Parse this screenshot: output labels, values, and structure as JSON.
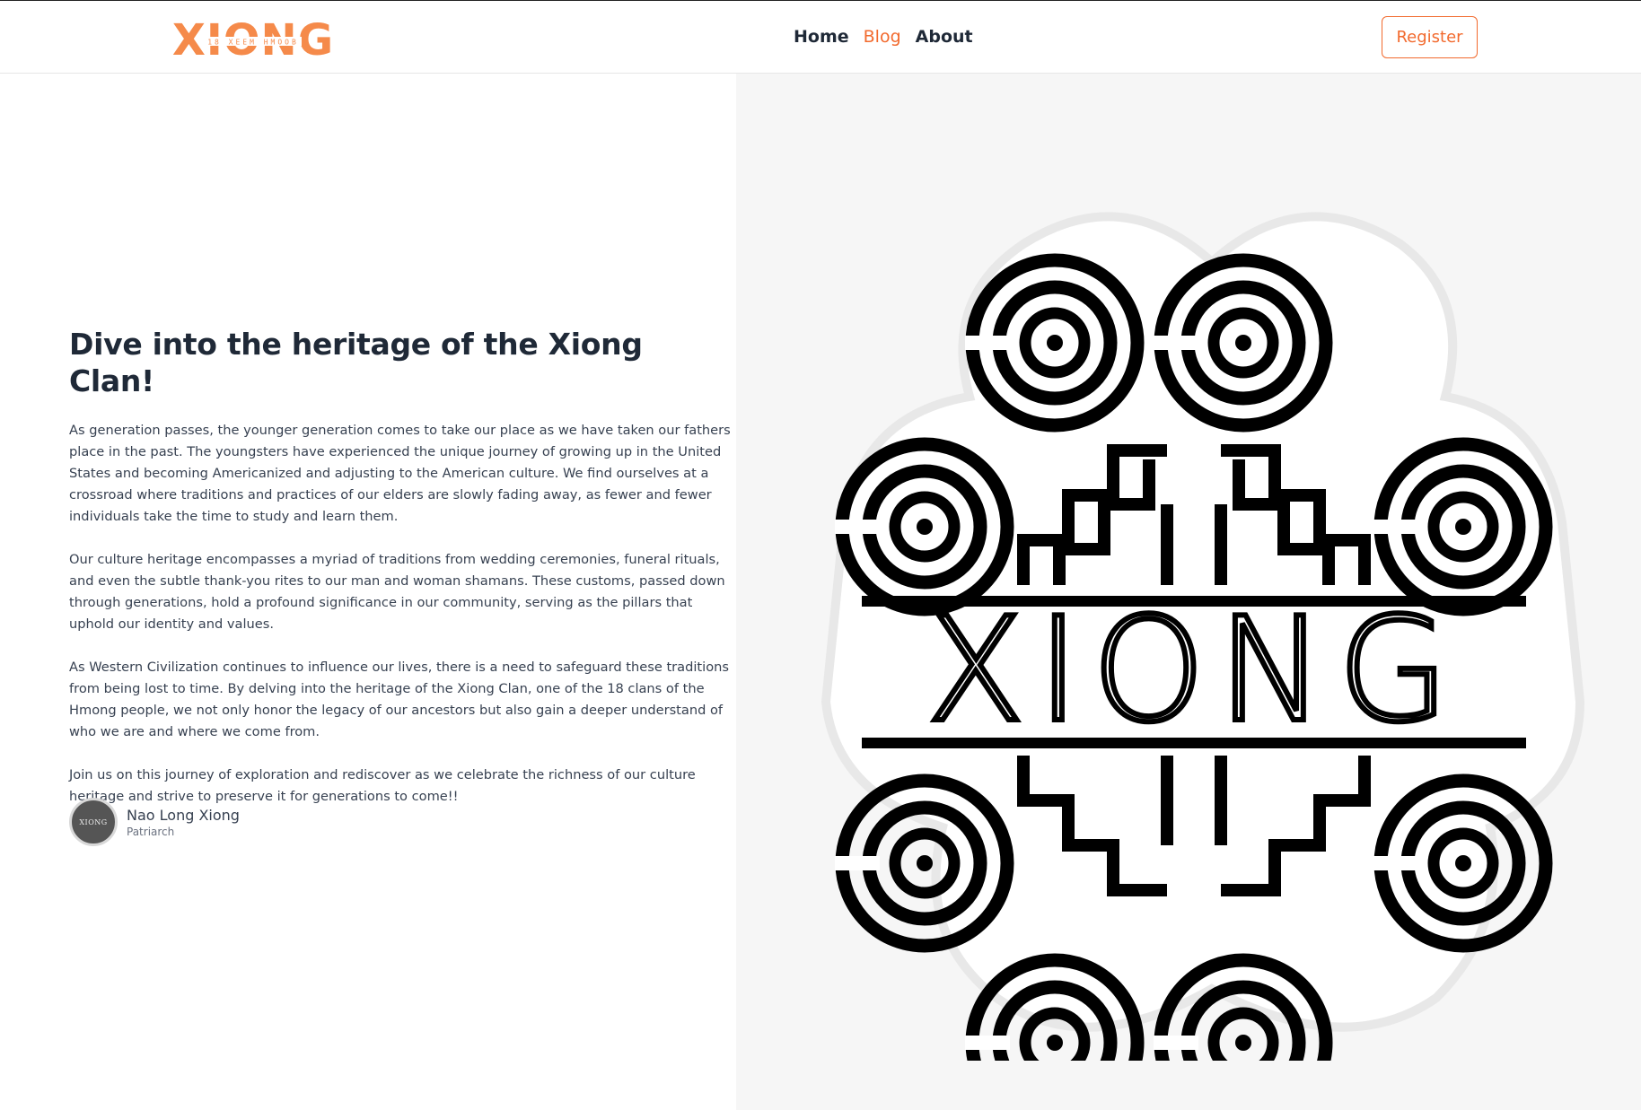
{
  "header": {
    "logo_text": "XIONG",
    "logo_subtext": "18 XEEM HMOOB",
    "nav": [
      {
        "label": "Home"
      },
      {
        "label": "Blog"
      },
      {
        "label": "About"
      }
    ],
    "register_label": "Register"
  },
  "colors": {
    "accent": "#f26a2e",
    "text": "#1f2937",
    "panel_bg": "#f6f6f6"
  },
  "hero": {
    "title": "Dive into the heritage of the Xiong Clan!",
    "paragraphs": [
      "As generation passes, the younger generation comes to take our place as we have taken our fathers place in the past. The youngsters have experienced the unique journey of growing up in the United States and becoming Americanized and adjusting to the American culture. We find ourselves at a crossroad where traditions and practices of our elders are slowly fading away, as fewer and fewer individuals take the time to study and learn them.",
      "Our culture heritage encompasses a myriad of traditions from wedding ceremonies, funeral rituals, and even the subtle thank-you rites to our man and woman shamans. These customs, passed down through generations, hold a profound significance in our community, serving as the pillars that uphold our identity and values.",
      "As Western Civilization continues to influence our lives, there is a need to safeguard these traditions from being lost to time. By delving into the heritage of the Xiong Clan, one of the 18 clans of the Hmong people, we not only honor the legacy of our ancestors but also gain a deeper understand of who we are and where we come from.",
      "Join us on this journey of exploration and rediscover as we celebrate the richness of our culture heritage and strive to preserve it for generations to come!!"
    ],
    "author": {
      "avatar_text": "XIONG",
      "name": "Nao Long Xiong",
      "role": "Patriarch"
    }
  },
  "emblem": {
    "text": "XIONG",
    "icon": "xiong-clan-emblem"
  }
}
